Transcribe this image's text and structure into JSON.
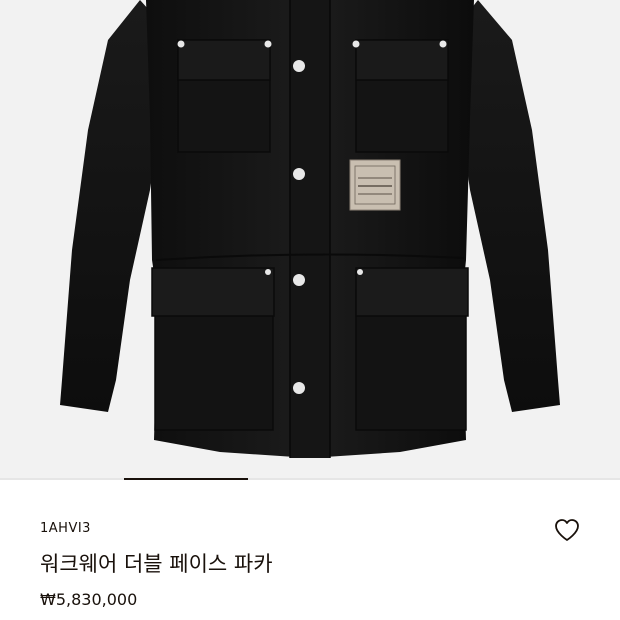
{
  "product": {
    "sku": "1AHVI3",
    "title": "워크웨어 더블 페이스 파카",
    "price": "₩5,830,000"
  },
  "gallery": {
    "image_subject": "black-workwear-parka",
    "indicator_index": 1,
    "background_color": "#f2f2f2",
    "garment_color": "#161616",
    "button_color": "#e8e8e8"
  },
  "icons": {
    "wishlist": "heart-outline-icon"
  },
  "colors": {
    "text": "#19110b",
    "indicator_active": "#19110b",
    "indicator_track": "#e6e6e6"
  }
}
